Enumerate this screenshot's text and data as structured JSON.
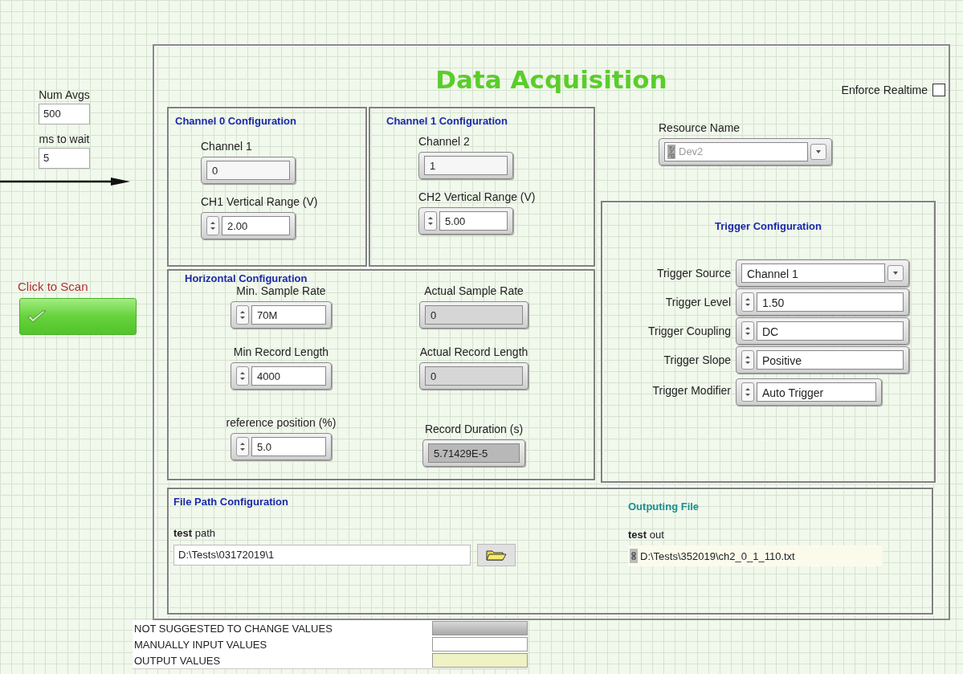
{
  "left_controls": [
    {
      "label": "Num Avgs",
      "value": "500"
    },
    {
      "label": "ms to wait",
      "value": "5"
    }
  ],
  "scan_button": {
    "label": "Click to Scan"
  },
  "title": "Data Acquisition",
  "enforce_realtime": {
    "label": "Enforce Realtime",
    "checked": false
  },
  "channel_panels": [
    {
      "title": "Channel 0 Configuration",
      "fields": [
        {
          "label": "Channel 1",
          "value": "0",
          "kind": "text"
        },
        {
          "label": "CH1 Vertical Range (V)",
          "value": "2.00",
          "kind": "numeric"
        }
      ]
    },
    {
      "title": "Channel 1 Configuration",
      "fields": [
        {
          "label": "Channel 2",
          "value": "1",
          "kind": "text"
        },
        {
          "label": "CH2 Vertical Range (V)",
          "value": "5.00",
          "kind": "numeric"
        }
      ]
    }
  ],
  "resource": {
    "label": "Resource Name",
    "value": "Dev2",
    "disabled": true
  },
  "horizontal": {
    "title": "Horizontal Configuration",
    "fields": [
      {
        "label": "Min. Sample Rate",
        "value": "70M",
        "kind": "numeric"
      },
      {
        "label": "Actual Sample Rate",
        "value": "0",
        "kind": "indicator"
      },
      {
        "label": "Min Record Length",
        "value": "4000",
        "kind": "numeric"
      },
      {
        "label": "Actual Record Length",
        "value": "0",
        "kind": "indicator"
      },
      {
        "label": "reference position (%)",
        "value": "5.0",
        "kind": "numeric"
      },
      {
        "label": "Record Duration (s)",
        "value": "5.71429E-5",
        "kind": "readout"
      }
    ]
  },
  "trigger": {
    "title": "Trigger Configuration",
    "fields": [
      {
        "label": "Trigger Source",
        "value": "Channel 1",
        "kind": "ring"
      },
      {
        "label": "Trigger Level",
        "value": "1.50",
        "kind": "numeric"
      },
      {
        "label": "Trigger Coupling",
        "value": "DC",
        "kind": "numeric"
      },
      {
        "label": "Trigger Slope",
        "value": "Positive",
        "kind": "numeric"
      },
      {
        "label": "Trigger Modifier",
        "value": "Auto Trigger",
        "kind": "numeric"
      }
    ]
  },
  "file_path": {
    "title": "File Path Configuration",
    "label": "**test** path",
    "value": "D:\\Tests\\03172019\\1"
  },
  "output_file": {
    "title": "Outputing File",
    "label": "**test** out",
    "value": "D:\\Tests\\352019\\ch2_0_1_110.txt"
  },
  "legend": [
    {
      "label": "NOT SUGGESTED TO CHANGE VALUES",
      "kind": "indicator"
    },
    {
      "label": "MANUALLY INPUT VALUES",
      "kind": "control"
    },
    {
      "label": "OUTPUT VALUES",
      "kind": "output"
    }
  ]
}
